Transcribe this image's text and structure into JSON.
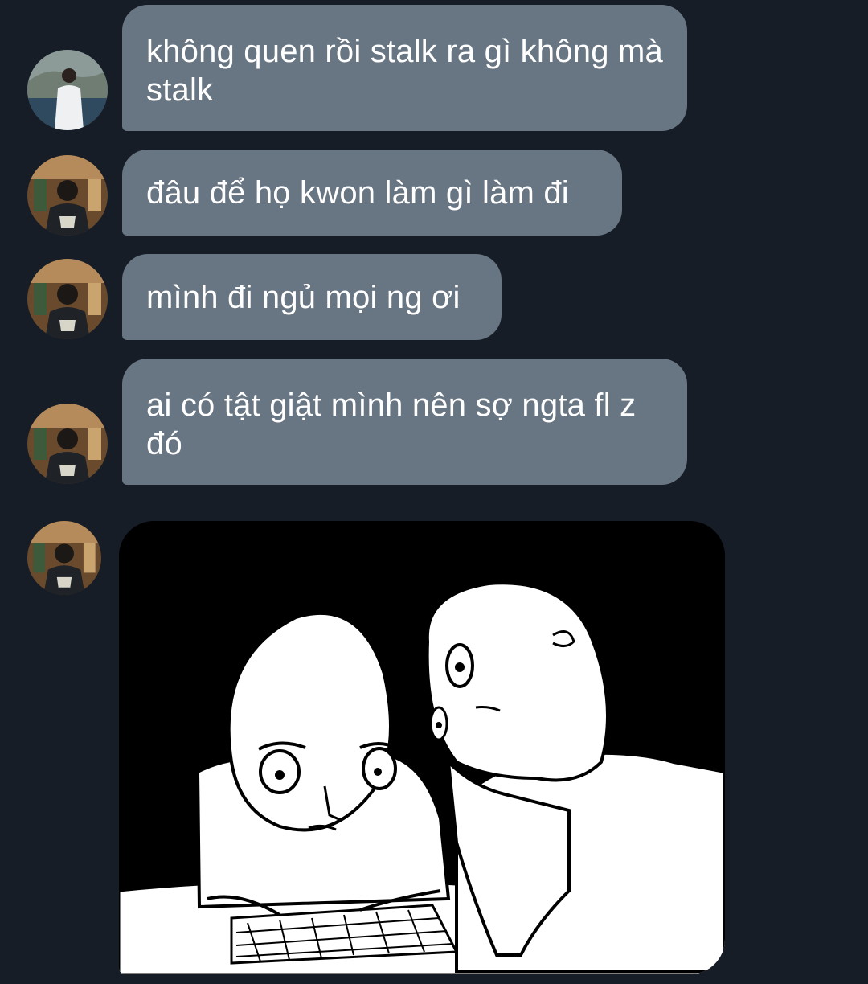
{
  "conversation": {
    "messages": [
      {
        "sender_avatar": "avatar-seaside-photo",
        "text": "không quen rồi stalk ra gì không mà stalk"
      },
      {
        "sender_avatar": "avatar-library-photo",
        "text": "đâu để họ kwon làm gì làm đi"
      },
      {
        "sender_avatar": "avatar-library-photo",
        "text": "mình đi ngủ mọi ng ơi"
      },
      {
        "sender_avatar": "avatar-library-photo",
        "text": "ai có tật giật mình nên sợ ngta fl z đó"
      },
      {
        "sender_avatar": "avatar-library-photo",
        "attachment": "image-sketch-two-figures-reading"
      }
    ]
  },
  "colors": {
    "background": "#161d27",
    "bubble": "#687582",
    "bubble_text": "#ffffff"
  }
}
